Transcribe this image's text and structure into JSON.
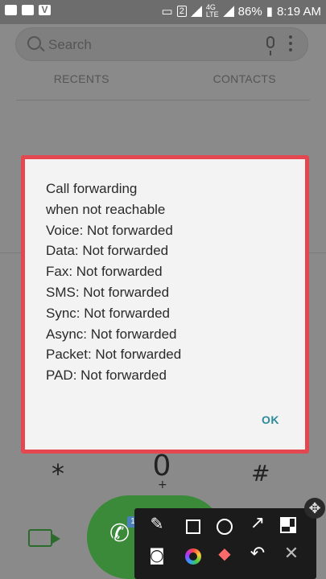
{
  "status_bar": {
    "badge": "2",
    "network": "4G",
    "network_sub": "LTE",
    "battery": "86%",
    "time": "8:19 AM"
  },
  "search": {
    "placeholder": "Search"
  },
  "tabs": [
    {
      "label": "RECENTS"
    },
    {
      "label": "CONTACTS"
    }
  ],
  "dialog": {
    "lines": [
      "Call forwarding",
      "when not reachable",
      "Voice: Not forwarded",
      "Data: Not forwarded",
      "Fax: Not forwarded",
      "SMS: Not forwarded",
      "Sync: Not forwarded",
      "Async: Not forwarded",
      "Packet: Not forwarded",
      "PAD: Not forwarded"
    ],
    "ok_label": "OK"
  },
  "keypad": {
    "star": "*",
    "zero": "0",
    "plus": "+",
    "hash": "#"
  },
  "call": {
    "sim_label": "1"
  },
  "colors": {
    "dialog_border": "#e4474f",
    "ok_text": "#2c8a9a",
    "call_green": "#3a8a3a"
  }
}
